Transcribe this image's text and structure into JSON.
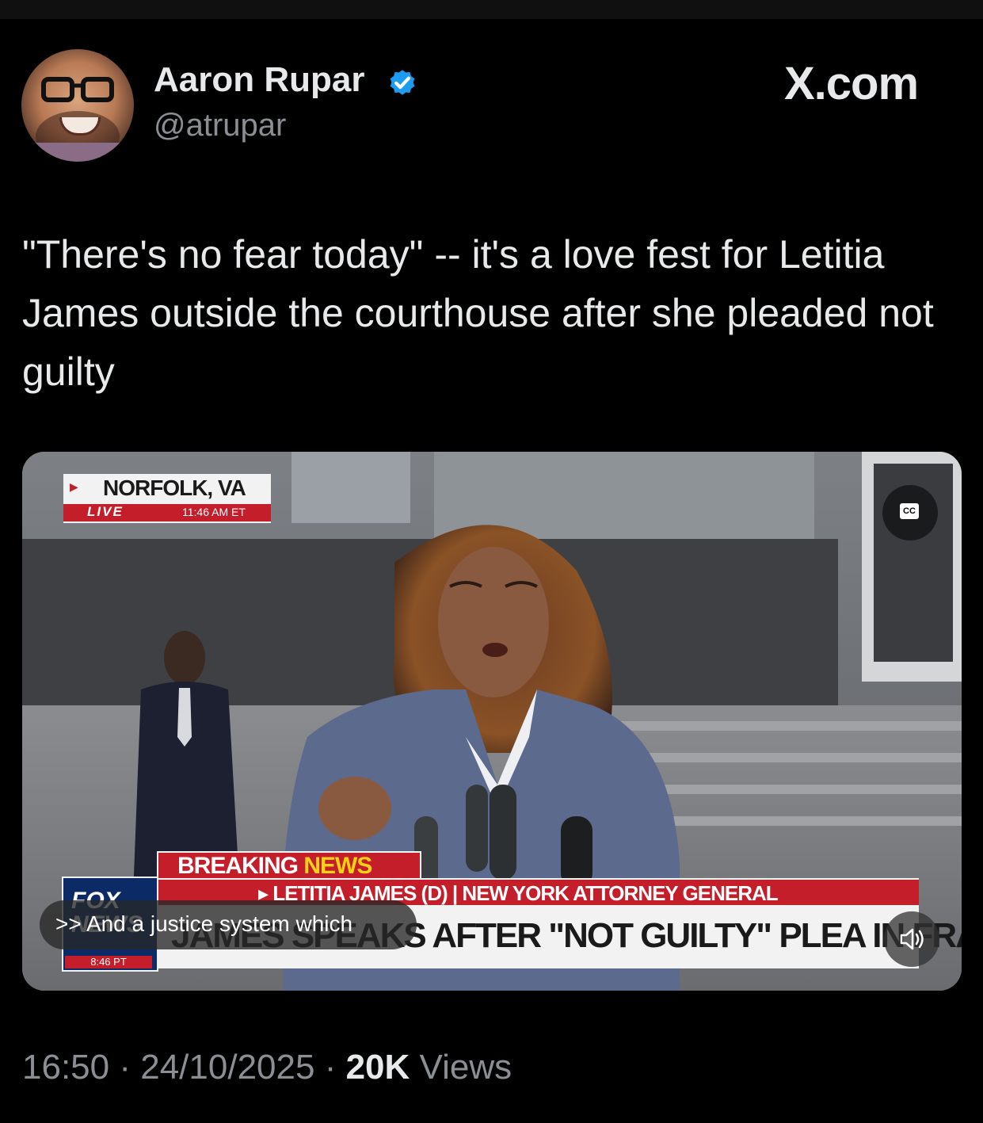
{
  "author": {
    "name": "Aaron Rupar",
    "handle": "@atrupar",
    "verified": true,
    "avatar_icon": "avatar-photo"
  },
  "watermark": "X.com",
  "tweet": {
    "text": "\"There's no fear today\" -- it's a love fest for Letitia James outside the courthouse after she pleaded not guilty"
  },
  "video": {
    "location": "NORFOLK, VA",
    "live_label": "LIVE",
    "live_time": "11:46 AM ET",
    "breaking_label_1": "BREAKING",
    "breaking_label_2": "NEWS",
    "name_bar": "▸ LETITIA JAMES (D) | NEW YORK ATTORNEY GENERAL",
    "headline": "JAMES SPEAKS AFTER \"NOT GUILTY\" PLEA IN FRAUD CASE",
    "network": "FOX NEWS",
    "network_time": "8:46 PT",
    "caption": ">> And a justice system which",
    "cc_label": "CC",
    "cc_icon": "closed-captions-icon",
    "sound_icon": "speaker-icon"
  },
  "meta": {
    "time": "16:50",
    "date": "24/10/2025",
    "views_count": "20K",
    "views_label": "Views",
    "separator": "·"
  },
  "colors": {
    "background": "#000000",
    "text_primary": "#e7e9ea",
    "text_secondary": "#8b8f94",
    "verified_blue": "#1d9bf0",
    "fox_red": "#c41e2a"
  }
}
